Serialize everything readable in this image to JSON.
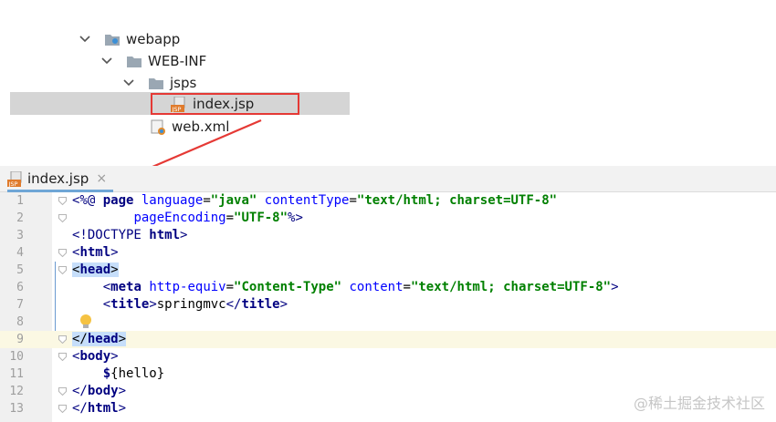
{
  "tree": {
    "items": [
      {
        "label": "webapp",
        "icon": "web-folder-icon"
      },
      {
        "label": "WEB-INF",
        "icon": "folder-icon"
      },
      {
        "label": "jsps",
        "icon": "folder-icon"
      },
      {
        "label": "index.jsp",
        "icon": "jsp-file-icon"
      },
      {
        "label": "web.xml",
        "icon": "xml-file-icon"
      }
    ]
  },
  "tab": {
    "label": "index.jsp",
    "close": "×"
  },
  "editor": {
    "line_numbers": [
      "1",
      "2",
      "3",
      "4",
      "5",
      "6",
      "7",
      "8",
      "9",
      "10",
      "11",
      "12",
      "13"
    ],
    "lines": [
      [
        [
          "t",
          "<%@ "
        ],
        [
          "tb",
          "page "
        ],
        [
          "at",
          "language"
        ],
        [
          "tx",
          "="
        ],
        [
          "st",
          "\"java\""
        ],
        [
          "tx",
          " "
        ],
        [
          "at",
          "contentType"
        ],
        [
          "tx",
          "="
        ],
        [
          "st",
          "\"text/html; charset=UTF-8\""
        ]
      ],
      [
        [
          "tx",
          "        "
        ],
        [
          "at",
          "pageEncoding"
        ],
        [
          "tx",
          "="
        ],
        [
          "st",
          "\"UTF-8\""
        ],
        [
          "t",
          "%>"
        ]
      ],
      [
        [
          "t",
          "<!DOCTYPE "
        ],
        [
          "tb",
          "html"
        ],
        [
          "t",
          ">"
        ]
      ],
      [
        [
          "t",
          "<"
        ],
        [
          "tb",
          "html"
        ],
        [
          "t",
          ">"
        ]
      ],
      [
        [
          "hl-tag",
          "<"
        ],
        [
          "hl-tag tb",
          "head"
        ],
        [
          "hl-tag",
          ">"
        ]
      ],
      [
        [
          "tx",
          "    "
        ],
        [
          "t",
          "<"
        ],
        [
          "tb",
          "meta "
        ],
        [
          "at",
          "http-equiv"
        ],
        [
          "tx",
          "="
        ],
        [
          "st",
          "\"Content-Type\""
        ],
        [
          "tx",
          " "
        ],
        [
          "at",
          "content"
        ],
        [
          "tx",
          "="
        ],
        [
          "st",
          "\"text/html; charset=UTF-8\""
        ],
        [
          "t",
          ">"
        ]
      ],
      [
        [
          "tx",
          "    "
        ],
        [
          "t",
          "<"
        ],
        [
          "tb",
          "title"
        ],
        [
          "t",
          ">"
        ],
        [
          "tx",
          "springmvc"
        ],
        [
          "t",
          "</"
        ],
        [
          "tb",
          "title"
        ],
        [
          "t",
          ">"
        ]
      ],
      [
        [
          "tx",
          ""
        ]
      ],
      [
        [
          "hl-tag",
          "</"
        ],
        [
          "hl-tag tb",
          "head"
        ],
        [
          "hl-tag",
          ">"
        ]
      ],
      [
        [
          "t",
          "<"
        ],
        [
          "tb",
          "body"
        ],
        [
          "t",
          ">"
        ]
      ],
      [
        [
          "tx",
          "    "
        ],
        [
          "tb",
          "$"
        ],
        [
          "tx",
          "{hello}"
        ]
      ],
      [
        [
          "t",
          "</"
        ],
        [
          "tb",
          "body"
        ],
        [
          "t",
          ">"
        ]
      ],
      [
        [
          "t",
          "</"
        ],
        [
          "tb",
          "html"
        ],
        [
          "t",
          ">"
        ]
      ]
    ]
  },
  "watermark": "@稀土掘金技术社区",
  "colors": {
    "highlight_box": "#e53935",
    "selection": "#d5d5d5",
    "active_line": "#fbf8e3"
  }
}
